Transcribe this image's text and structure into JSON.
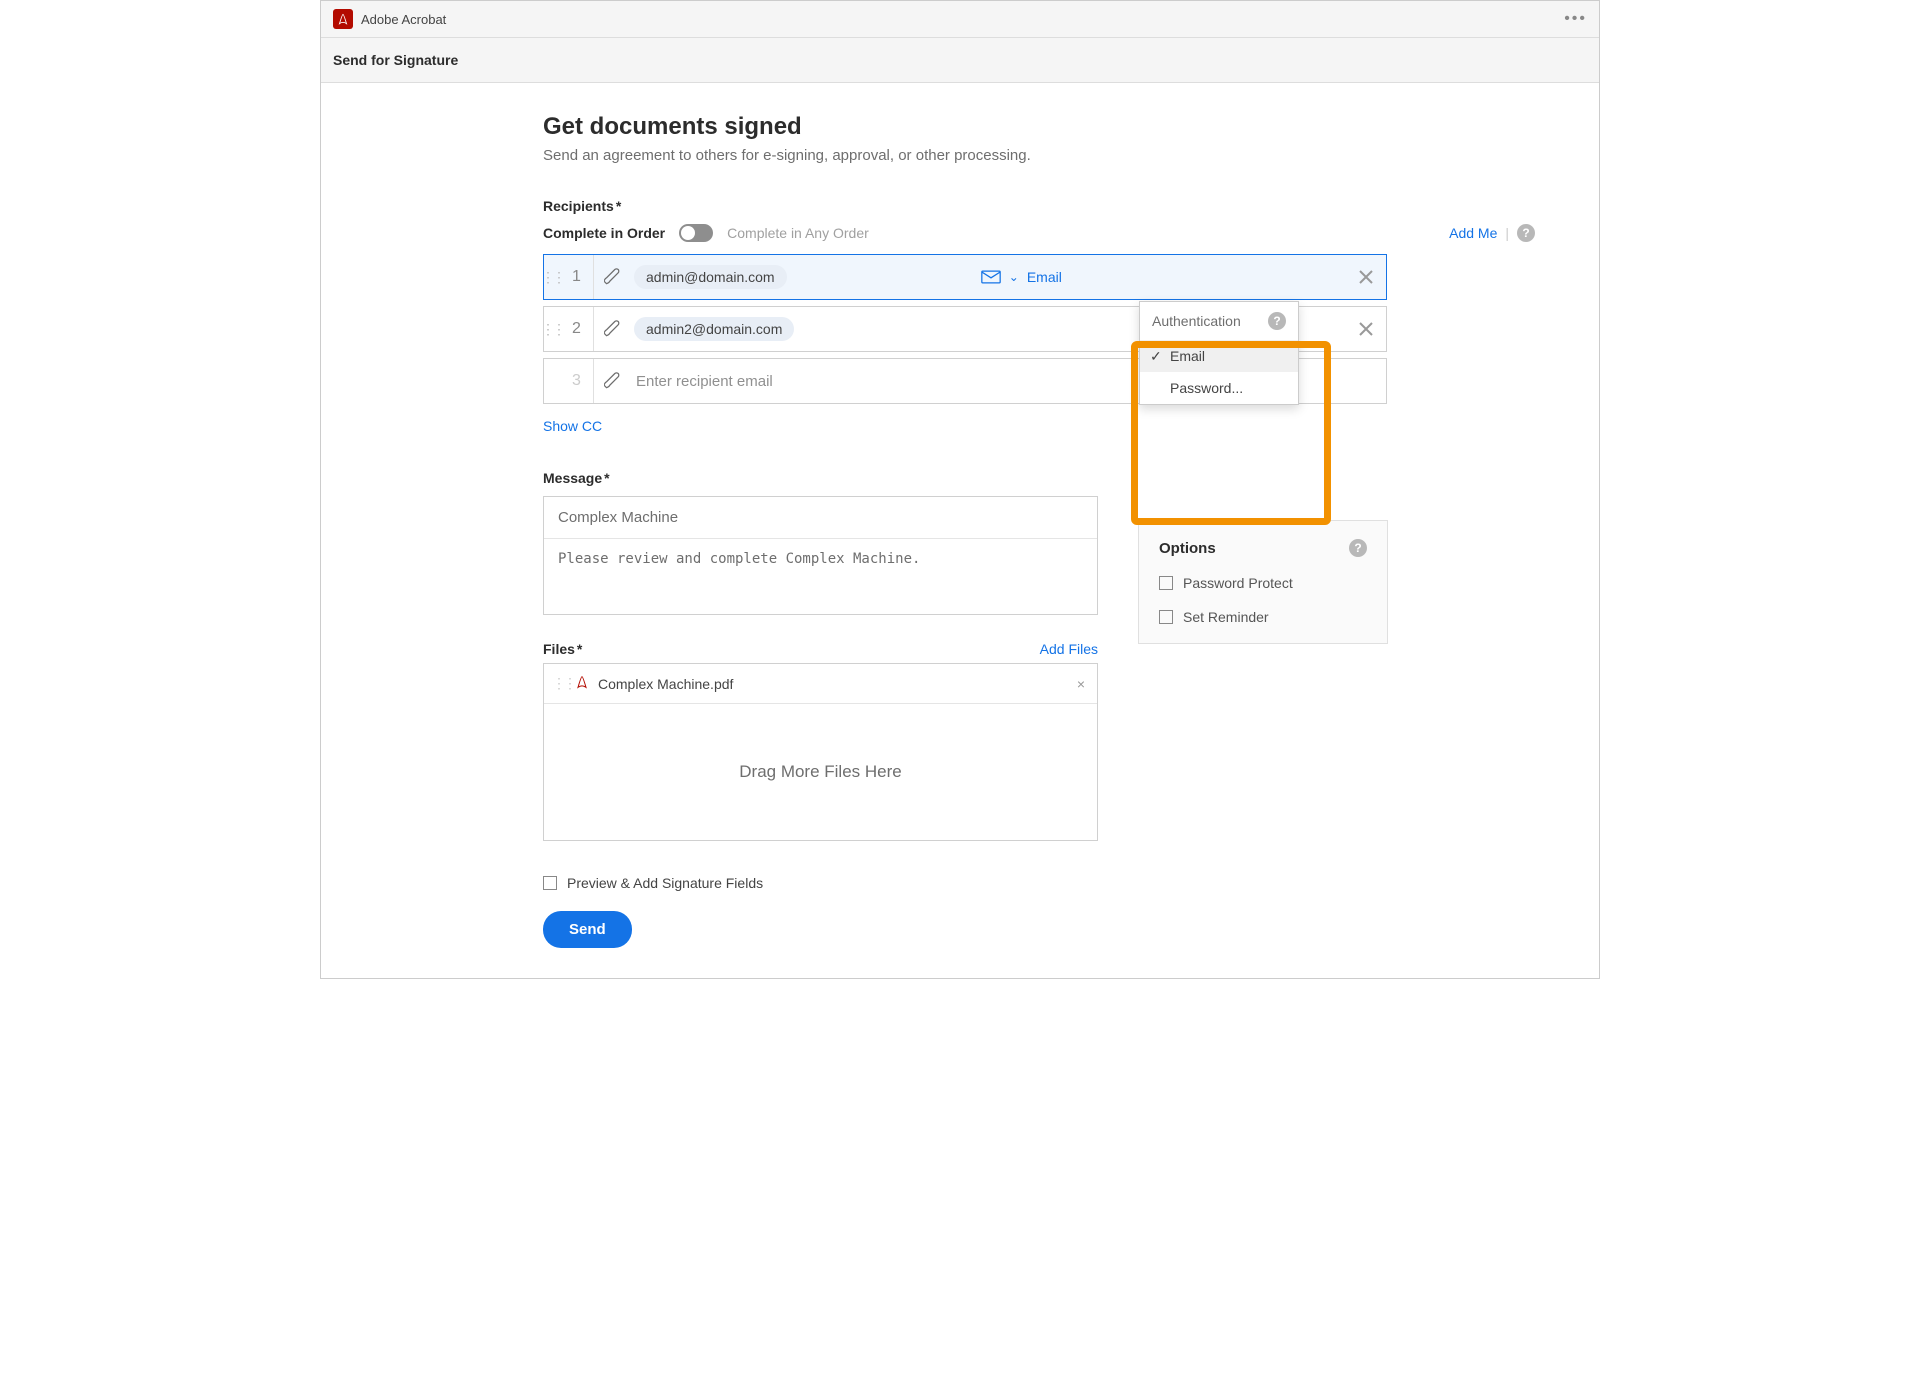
{
  "app": {
    "name": "Adobe Acrobat",
    "subhead": "Send for Signature"
  },
  "page": {
    "title": "Get documents signed",
    "subtitle": "Send an agreement to others for e-signing, approval, or other processing."
  },
  "recipients": {
    "label": "Recipients",
    "completeInOrder": "Complete in Order",
    "completeAnyOrder": "Complete in Any Order",
    "addMe": "Add Me",
    "rows": [
      {
        "num": "1",
        "email": "admin@domain.com",
        "auth": "Email"
      },
      {
        "num": "2",
        "email": "admin2@domain.com"
      },
      {
        "num": "3",
        "placeholder": "Enter recipient email"
      }
    ],
    "showCC": "Show CC",
    "authDropdown": {
      "header": "Authentication",
      "email": "Email",
      "password": "Password..."
    }
  },
  "message": {
    "label": "Message",
    "subject": "Complex Machine",
    "body": "Please review and complete Complex Machine."
  },
  "options": {
    "label": "Options",
    "passwordProtect": "Password Protect",
    "setReminder": "Set Reminder"
  },
  "files": {
    "label": "Files",
    "addFiles": "Add Files",
    "items": [
      {
        "name": "Complex Machine.pdf"
      }
    ],
    "dragText": "Drag More Files Here"
  },
  "preview": {
    "label": "Preview & Add Signature Fields"
  },
  "send": {
    "label": "Send"
  }
}
